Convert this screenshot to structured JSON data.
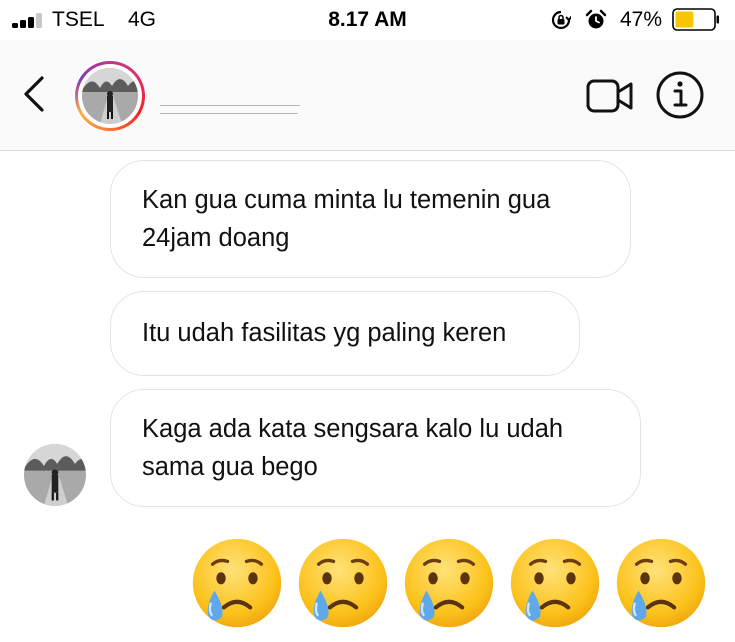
{
  "status_bar": {
    "carrier": "TSEL",
    "network": "4G",
    "time": "8.17 AM",
    "battery_percent": "47%",
    "battery_level": 0.47,
    "signal_bars": 3,
    "signal_bars_total": 4,
    "icons": [
      "signal-icon",
      "rotation-lock-icon",
      "alarm-icon",
      "battery-icon"
    ]
  },
  "header": {
    "icons": [
      "back-chevron-icon",
      "video-call-icon",
      "info-icon"
    ],
    "avatar_ring_colors": [
      "#c13584",
      "#e1306c",
      "#fd1d1d",
      "#f77737",
      "#fcaf45",
      "#833ab4"
    ]
  },
  "messages": [
    {
      "lines": [
        "Kan gua cuma minta lu temenin gua",
        "24jam doang"
      ]
    },
    {
      "lines": [
        "Itu udah fasilitas yg paling keren"
      ]
    },
    {
      "lines": [
        "Kaga ada kata sengsara kalo lu udah",
        "sama gua bego"
      ]
    }
  ],
  "reaction": {
    "emoji": "crying-face",
    "count": 5
  },
  "colors": {
    "battery_fill": "#f7c600",
    "bubble_border": "#e3e3e3",
    "tear": "#5fa8ea",
    "emoji_face": "#fcc21b"
  }
}
